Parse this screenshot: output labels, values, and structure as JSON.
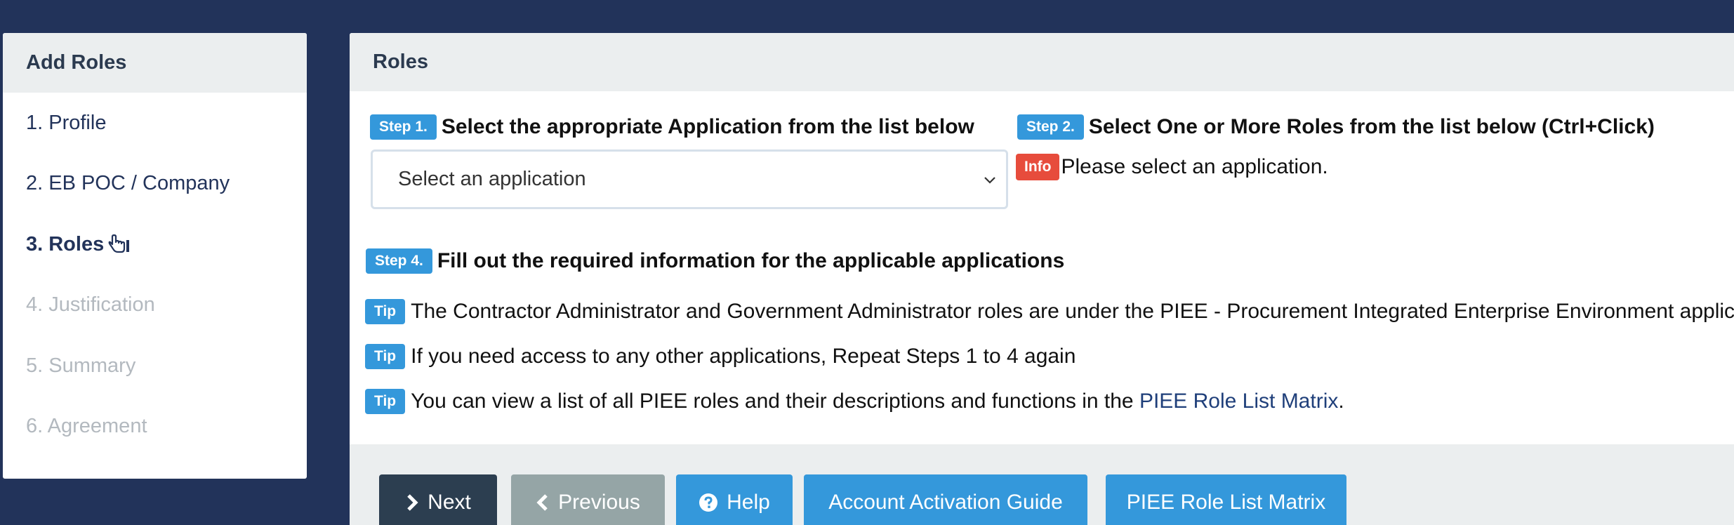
{
  "sidebar": {
    "title": "Add Roles",
    "items": [
      {
        "label": "1. Profile",
        "state": "normal"
      },
      {
        "label": "2. EB POC / Company",
        "state": "normal"
      },
      {
        "label": "3. Roles",
        "state": "active"
      },
      {
        "label": "4. Justification",
        "state": "disabled"
      },
      {
        "label": "5. Summary",
        "state": "disabled"
      },
      {
        "label": "6. Agreement",
        "state": "disabled"
      }
    ]
  },
  "main": {
    "title": "Roles",
    "step1": {
      "badge": "Step 1.",
      "text": "Select the appropriate Application from the list below"
    },
    "step2": {
      "badge": "Step 2.",
      "text": "Select One or More Roles from the list below (Ctrl+Click)"
    },
    "step4": {
      "badge": "Step 4.",
      "text": "Fill out the required information for the applicable applications"
    },
    "select": {
      "value": "Select an application"
    },
    "info": {
      "badge": "Info",
      "text": "Please select an application."
    },
    "tips": [
      {
        "badge": "Tip",
        "text": "The Contractor Administrator and Government Administrator roles are under the PIEE - Procurement Integrated Enterprise Environment applica"
      },
      {
        "badge": "Tip",
        "text": "If you need access to any other applications, Repeat Steps 1 to 4 again"
      },
      {
        "badge": "Tip",
        "text": "You can view a list of all PIEE roles and their descriptions and functions in the ",
        "link": "PIEE Role List Matrix",
        "after": "."
      }
    ]
  },
  "buttons": {
    "next": "Next",
    "previous": "Previous",
    "help": "Help",
    "guide": "Account Activation Guide",
    "matrix": "PIEE Role List Matrix"
  },
  "colors": {
    "background": "#22335a",
    "badge_blue": "#3498db",
    "badge_red": "#e74c3c",
    "next_button": "#2c3e50",
    "previous_button": "#95a5a6"
  },
  "icons": {
    "active_item_icon": "hand-pointer-icon",
    "next": "chevron-right-icon",
    "previous": "chevron-left-icon",
    "help": "question-circle-icon",
    "select": "chevron-down-icon"
  }
}
